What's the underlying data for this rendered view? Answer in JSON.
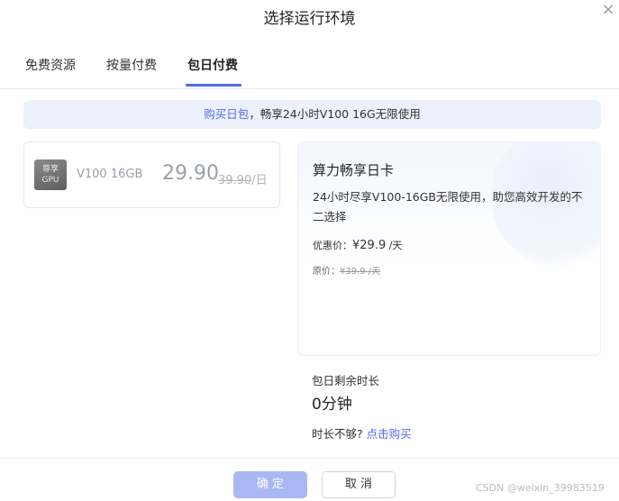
{
  "dialog": {
    "title": "选择运行环境",
    "close_icon": "close-icon ×"
  },
  "tabs": [
    {
      "label": "免费资源",
      "active": false
    },
    {
      "label": "按量付费",
      "active": false
    },
    {
      "label": "包日付费",
      "active": true
    }
  ],
  "notice": {
    "link": "购买日包",
    "text": "，畅享24小时V100 16G无限使用"
  },
  "plan": {
    "icon_line1": "尊享",
    "icon_line2": "GPU",
    "name": "V100 16GB",
    "price": "29.90",
    "original_price": "39.90",
    "unit": "/日"
  },
  "detail": {
    "title": "算力畅享日卡",
    "description": "24小时尽享V100-16GB无限使用，助您高效开发的不二选择",
    "discount_label": "优惠价：",
    "discount_price": "¥29.9",
    "discount_unit": " /天",
    "original_label": "原价：",
    "original_price": "¥39.9 /天"
  },
  "remaining": {
    "label": "包日剩余时长",
    "value": "0分钟",
    "prompt": "时长不够? ",
    "link": "点击购买"
  },
  "footer": {
    "confirm": "确 定",
    "cancel": "取 消"
  },
  "watermark": "CSDN @weixin_39983519",
  "colors": {
    "accent": "#4e6ef2",
    "notice_bg": "#edf1fd",
    "confirm_disabled": "#a9b8f5"
  }
}
